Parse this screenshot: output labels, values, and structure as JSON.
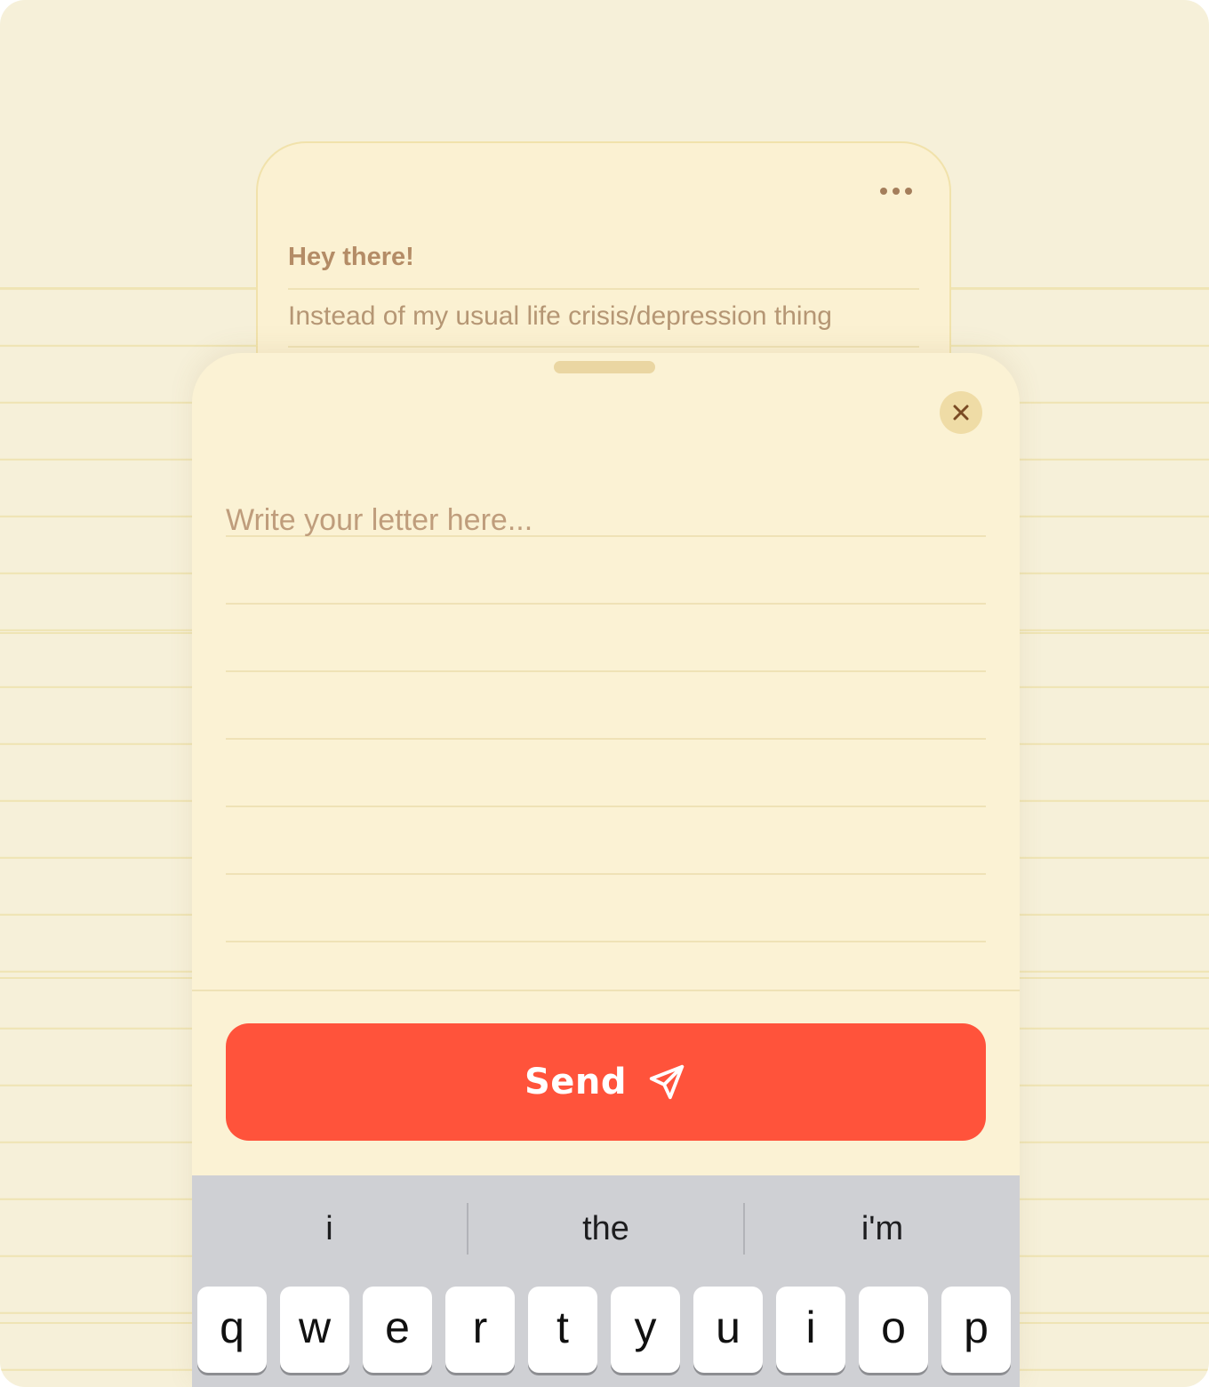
{
  "background_letter": {
    "greeting": "Hey there!",
    "preview": "Instead of my usual life crisis/depression thing",
    "menu_icon": "more-horizontal-icon"
  },
  "compose": {
    "placeholder": "Write your letter here...",
    "close_icon": "close-icon",
    "send_label": "Send",
    "send_icon": "paper-plane-icon",
    "accent_color": "#ff533b"
  },
  "keyboard": {
    "suggestions": [
      "i",
      "the",
      "i'm"
    ],
    "top_row": [
      "q",
      "w",
      "e",
      "r",
      "t",
      "y",
      "u",
      "i",
      "o",
      "p"
    ]
  }
}
